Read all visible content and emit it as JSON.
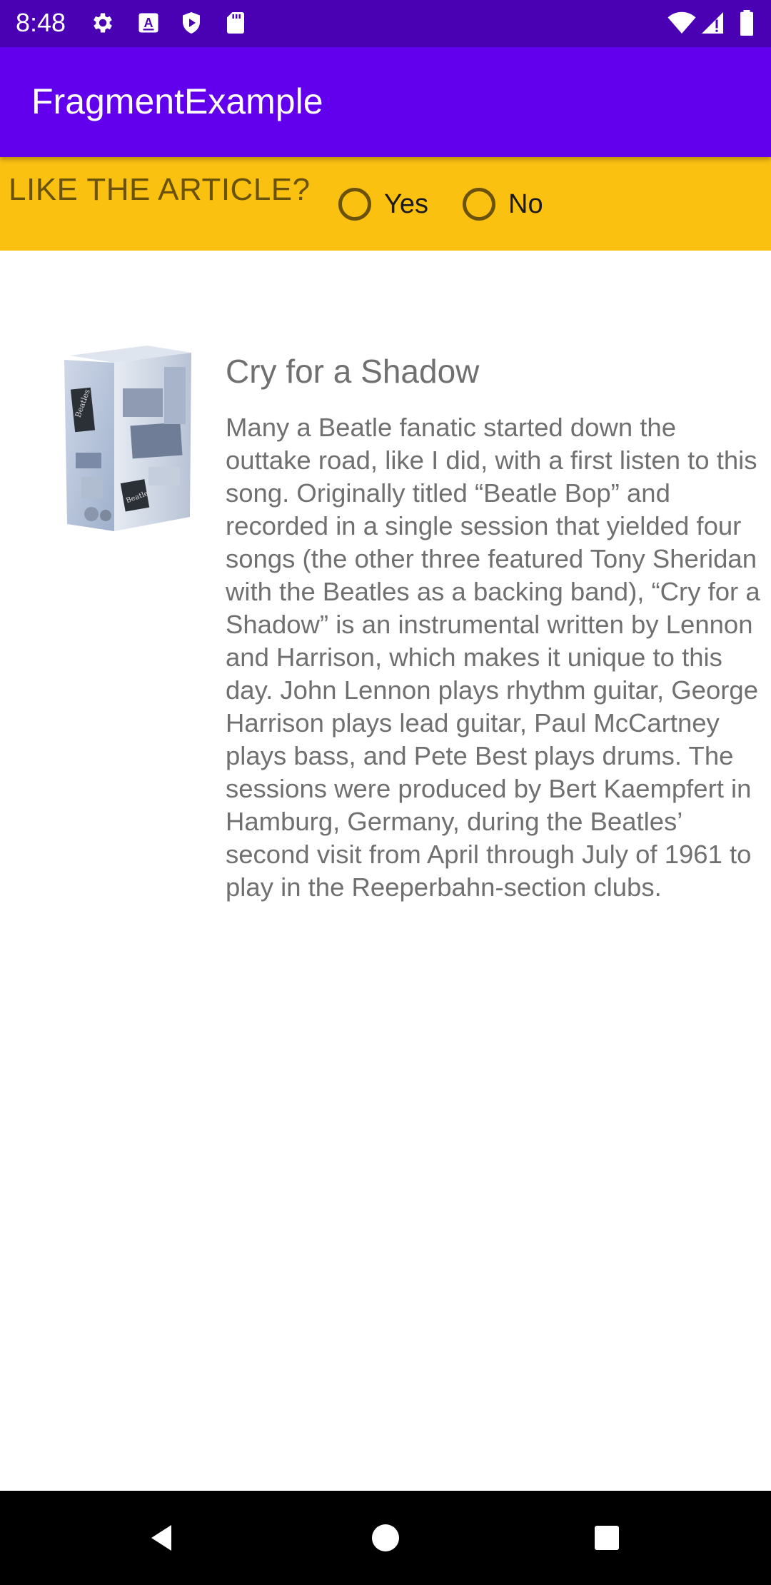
{
  "status_bar": {
    "time": "8:48",
    "icons": [
      "gear-icon",
      "a-box-icon",
      "play-shield-icon",
      "sd-card-icon",
      "wifi-icon",
      "signal-icon",
      "battery-icon"
    ],
    "background_color": "#4a00b3"
  },
  "app_bar": {
    "title": "FragmentExample",
    "background_color": "#6200ee"
  },
  "question": {
    "label": "LIKE THE ARTICLE?",
    "background_color": "#fbc111",
    "options": [
      {
        "label": "Yes",
        "selected": false
      },
      {
        "label": "No",
        "selected": false
      }
    ]
  },
  "article": {
    "image": "album-box-set-image",
    "title": "Cry for a Shadow",
    "body": "Many a Beatle fanatic started down the outtake road, like I did, with a first listen to this song. Originally titled “Beatle Bop” and recorded in a single session that yielded four songs (the other three featured Tony Sheridan with the Beatles as a backing band), “Cry for a Shadow” is an instrumental written by Lennon and Harrison, which makes it unique to this day. John Lennon plays rhythm guitar, George Harrison plays lead guitar, Paul McCartney plays bass, and Pete Best plays drums. The sessions were produced by Bert Kaempfert in Hamburg, Germany, during the Beatles’ second visit from April through July of 1961 to play in the Reeperbahn-section clubs.",
    "text_color": "#707070"
  },
  "nav_bar": {
    "buttons": [
      "back-icon",
      "home-icon",
      "recents-icon"
    ]
  }
}
